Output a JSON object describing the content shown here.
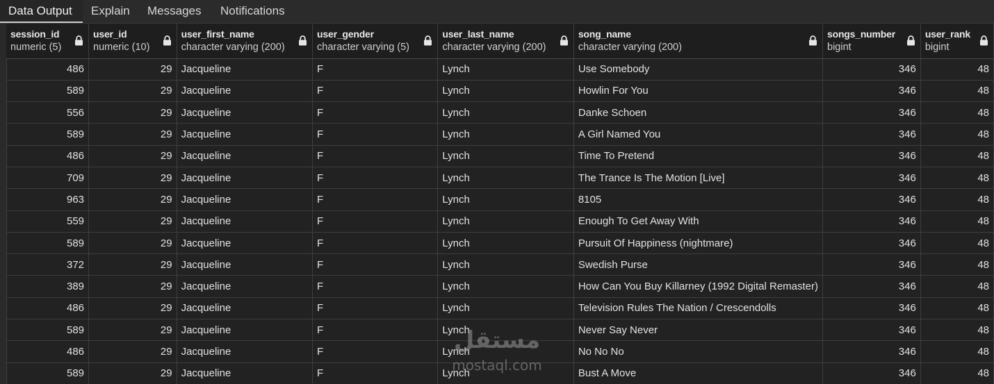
{
  "tabs": [
    {
      "label": "Data Output",
      "active": true
    },
    {
      "label": "Explain",
      "active": false
    },
    {
      "label": "Messages",
      "active": false
    },
    {
      "label": "Notifications",
      "active": false
    }
  ],
  "columns": [
    {
      "name": "session_id",
      "type": "numeric (5)",
      "icon": "lock-icon"
    },
    {
      "name": "user_id",
      "type": "numeric (10)",
      "icon": "lock-icon"
    },
    {
      "name": "user_first_name",
      "type": "character varying (200)",
      "icon": "lock-icon"
    },
    {
      "name": "user_gender",
      "type": "character varying (5)",
      "icon": "lock-icon"
    },
    {
      "name": "user_last_name",
      "type": "character varying (200)",
      "icon": "lock-icon"
    },
    {
      "name": "song_name",
      "type": "character varying (200)",
      "icon": "lock-icon"
    },
    {
      "name": "songs_number",
      "type": "bigint",
      "icon": "lock-icon"
    },
    {
      "name": "user_rank",
      "type": "bigint",
      "icon": "lock-icon"
    }
  ],
  "rows": [
    [
      "486",
      "29",
      "Jacqueline",
      "F",
      "Lynch",
      "Use Somebody",
      "346",
      "48"
    ],
    [
      "589",
      "29",
      "Jacqueline",
      "F",
      "Lynch",
      "Howlin\u0019 For You",
      "346",
      "48"
    ],
    [
      "556",
      "29",
      "Jacqueline",
      "F",
      "Lynch",
      "Danke Schoen",
      "346",
      "48"
    ],
    [
      "589",
      "29",
      "Jacqueline",
      "F",
      "Lynch",
      "A Girl Named You",
      "346",
      "48"
    ],
    [
      "486",
      "29",
      "Jacqueline",
      "F",
      "Lynch",
      "Time To Pretend",
      "346",
      "48"
    ],
    [
      "709",
      "29",
      "Jacqueline",
      "F",
      "Lynch",
      "The Trance Is The Motion [Live]",
      "346",
      "48"
    ],
    [
      "963",
      "29",
      "Jacqueline",
      "F",
      "Lynch",
      "8105",
      "346",
      "48"
    ],
    [
      "559",
      "29",
      "Jacqueline",
      "F",
      "Lynch",
      "Enough To Get Away With",
      "346",
      "48"
    ],
    [
      "589",
      "29",
      "Jacqueline",
      "F",
      "Lynch",
      "Pursuit Of Happiness (nightmare)",
      "346",
      "48"
    ],
    [
      "372",
      "29",
      "Jacqueline",
      "F",
      "Lynch",
      "Swedish Purse",
      "346",
      "48"
    ],
    [
      "389",
      "29",
      "Jacqueline",
      "F",
      "Lynch",
      "How Can You Buy Killarney (1992 Digital Remaster)",
      "346",
      "48"
    ],
    [
      "486",
      "29",
      "Jacqueline",
      "F",
      "Lynch",
      "Television Rules The Nation / Crescendolls",
      "346",
      "48"
    ],
    [
      "589",
      "29",
      "Jacqueline",
      "F",
      "Lynch",
      "Never Say Never",
      "346",
      "48"
    ],
    [
      "486",
      "29",
      "Jacqueline",
      "F",
      "Lynch",
      "No No No",
      "346",
      "48"
    ],
    [
      "589",
      "29",
      "Jacqueline",
      "F",
      "Lynch",
      "Bust A Move",
      "346",
      "48"
    ]
  ],
  "watermark": {
    "arabic": "مستقل",
    "latin": "mostaql.com"
  },
  "colors": {
    "background": "#222222",
    "header": "#1e1e1e",
    "grid_line": "#3e3e3e",
    "text": "#e2e2e2"
  }
}
